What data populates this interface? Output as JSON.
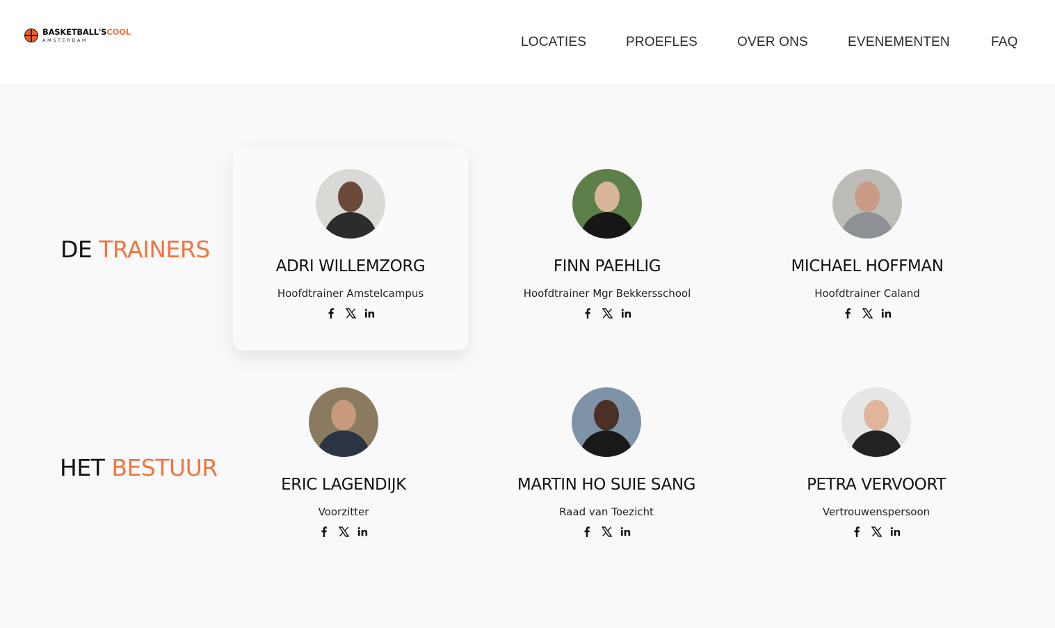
{
  "brand": {
    "main": "BASKETBALL'S",
    "accent": "COOL",
    "sub": "AMSTERDAM"
  },
  "nav": [
    {
      "label": "LOCATIES"
    },
    {
      "label": "PROEFLES"
    },
    {
      "label": "OVER ONS"
    },
    {
      "label": "EVENEMENTEN"
    },
    {
      "label": "FAQ"
    }
  ],
  "trainers": {
    "title_dark": "DE",
    "title_accent": "TRAINERS",
    "people": [
      {
        "name": "ADRI WILLEMZORG",
        "role": "Hoofdtrainer Amstelcampus"
      },
      {
        "name": "FINN PAEHLIG",
        "role": "Hoofdtrainer Mgr Bekkersschool"
      },
      {
        "name": "MICHAEL HOFFMAN",
        "role": "Hoofdtrainer Caland"
      }
    ]
  },
  "board": {
    "title_dark": "HET",
    "title_accent": "BESTUUR",
    "people": [
      {
        "name": "ERIC LAGENDIJK",
        "role": "Voorzitter"
      },
      {
        "name": "MARTIN HO SUIE SANG",
        "role": "Raad van Toezicht"
      },
      {
        "name": "PETRA VERVOORT",
        "role": "Vertrouwenspersoon"
      }
    ]
  },
  "colors": {
    "accent": "#f07540",
    "text": "#111111",
    "background": "#f9f9f9",
    "header": "#ffffff"
  },
  "icons": [
    "basketball-icon",
    "facebook-icon",
    "x-icon",
    "linkedin-icon"
  ]
}
